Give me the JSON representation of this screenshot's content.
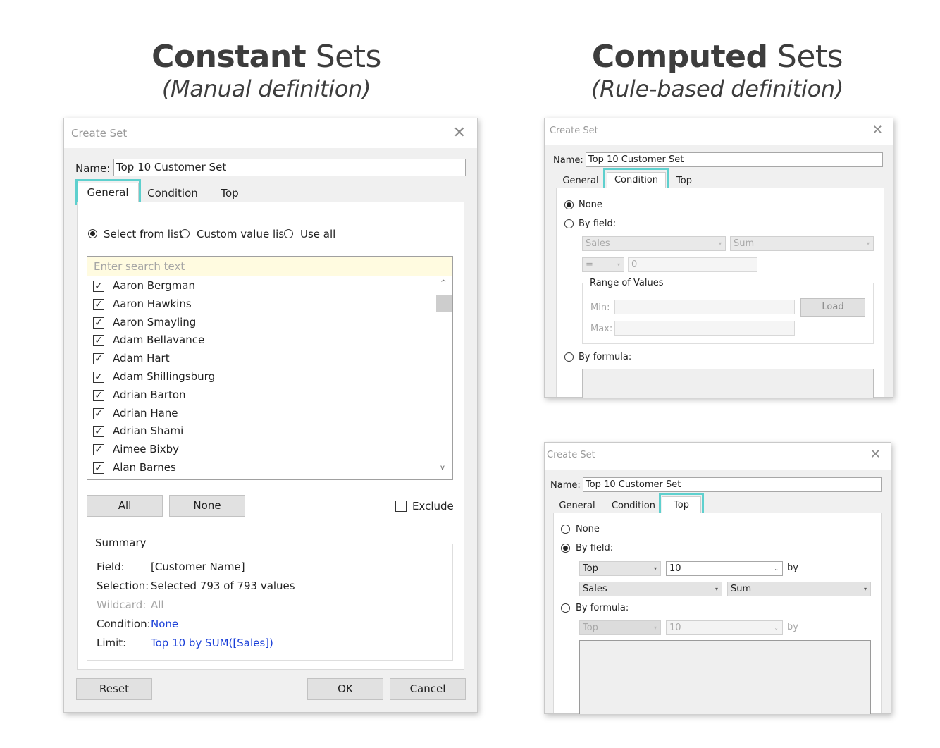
{
  "left_heading": {
    "bold": "Constant",
    "rest": " Sets",
    "subtitle": "(Manual definition)"
  },
  "right_heading": {
    "bold": "Computed",
    "rest": " Sets",
    "subtitle": "(Rule-based definition)"
  },
  "accent_color": "#5ed0ce",
  "dialog1": {
    "title": "Create Set",
    "name_label": "Name:",
    "name_value": "Top 10 Customer Set",
    "tabs": [
      "General",
      "Condition",
      "Top"
    ],
    "mode_options": [
      "Select from list",
      "Custom value list",
      "Use all"
    ],
    "search_placeholder": "Enter search text",
    "items": [
      "Aaron Bergman",
      "Aaron Hawkins",
      "Aaron Smayling",
      "Adam Bellavance",
      "Adam Hart",
      "Adam Shillingsburg",
      "Adrian Barton",
      "Adrian Hane",
      "Adrian Shami",
      "Aimee Bixby",
      "Alan Barnes"
    ],
    "all_button": "All",
    "none_button": "None",
    "exclude_label": "Exclude",
    "summary": {
      "title": "Summary",
      "field_label": "Field:",
      "field_value": "[Customer Name]",
      "selection_label": "Selection:",
      "selection_value": "Selected 793 of 793 values",
      "wildcard_label": "Wildcard:",
      "wildcard_value": "All",
      "condition_label": "Condition:",
      "condition_value": "None",
      "limit_label": "Limit:",
      "limit_value": "Top 10 by SUM([Sales])"
    },
    "reset_button": "Reset",
    "ok_button": "OK",
    "cancel_button": "Cancel"
  },
  "dialog2": {
    "title": "Create Set",
    "name_label": "Name:",
    "name_value": "Top 10 Customer Set",
    "tabs": [
      "General",
      "Condition",
      "Top"
    ],
    "none_label": "None",
    "by_field_label": "By field:",
    "field_select": "Sales",
    "agg_select": "Sum",
    "op_select": "=",
    "value": "0",
    "range_title": "Range of Values",
    "min_label": "Min:",
    "max_label": "Max:",
    "load_button": "Load",
    "by_formula_label": "By formula:"
  },
  "dialog3": {
    "title": "Create Set",
    "name_label": "Name:",
    "name_value": "Top 10 Customer Set",
    "tabs": [
      "General",
      "Condition",
      "Top"
    ],
    "none_label": "None",
    "by_field_label": "By field:",
    "top_select": "Top",
    "count_select": "10",
    "by_label": "by",
    "field_select": "Sales",
    "agg_select": "Sum",
    "by_formula_label": "By formula:",
    "formula_top_select": "Top",
    "formula_count_select": "10",
    "formula_by_label": "by"
  }
}
